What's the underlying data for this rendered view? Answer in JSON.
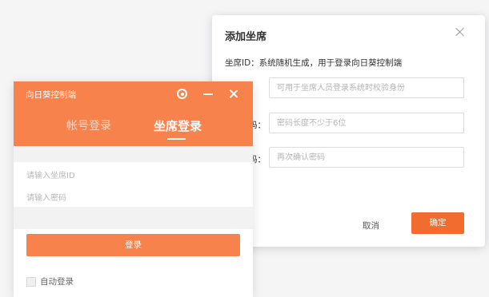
{
  "add_seat_dialog": {
    "title": "添加坐席",
    "hint": "坐席ID：系统随机生成，用于登录向日葵控制端",
    "fields": [
      {
        "label": "",
        "placeholder": "可用于坐席人员登录系统时校验身份"
      },
      {
        "label": "码：",
        "placeholder": "密码长度不少于6位"
      },
      {
        "label": "码：",
        "placeholder": "再次确认密码"
      }
    ],
    "cancel_label": "取消",
    "confirm_label": "确定",
    "accent_color": "#f26b2f"
  },
  "login_window": {
    "app_title": "向日葵控制端",
    "tabs": [
      {
        "label": "帐号登录",
        "active": false
      },
      {
        "label": "坐席登录",
        "active": true
      }
    ],
    "seat_id_placeholder": "请输入坐席ID",
    "password_placeholder": "请输入密码",
    "login_label": "登录",
    "auto_login_label": "自动登录",
    "header_color": "#f7824c"
  }
}
